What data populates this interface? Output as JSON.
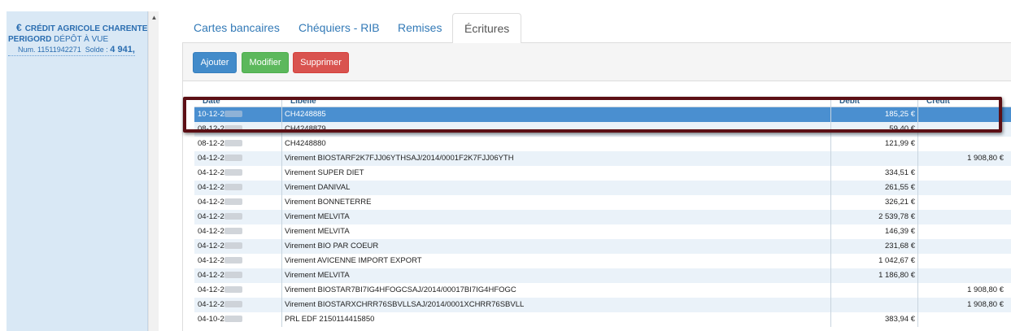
{
  "account": {
    "currency_symbol": "€",
    "bank_name": "CRÉDIT AGRICOLE CHARENTE",
    "region": "PERIGORD",
    "type": "DÉPÔT À VUE",
    "number_label": "Num. 11511942271",
    "balance_label": "Solde :",
    "balance_value": "4 941,"
  },
  "scroll_up_icon": "▲",
  "tabs": [
    {
      "label": "Cartes bancaires",
      "active": false
    },
    {
      "label": "Chéquiers - RIB",
      "active": false
    },
    {
      "label": "Remises",
      "active": false
    },
    {
      "label": "Écritures",
      "active": true
    }
  ],
  "toolbar": {
    "add_label": "Ajouter",
    "edit_label": "Modifier",
    "delete_label": "Supprimer"
  },
  "table": {
    "columns": [
      "Date",
      "Libellé",
      "Débit",
      "Crédit"
    ],
    "rows": [
      {
        "date": "10-12-2",
        "libelle": "CH4248885",
        "debit": "185,25 €",
        "credit": ""
      },
      {
        "date": "08-12-2",
        "libelle": "CH4248879",
        "debit": "59,40 €",
        "credit": ""
      },
      {
        "date": "08-12-2",
        "libelle": "CH4248880",
        "debit": "121,99 €",
        "credit": ""
      },
      {
        "date": "04-12-2",
        "libelle": "Virement BIOSTARF2K7FJJ06YTHSAJ/2014/0001F2K7FJJ06YTH",
        "debit": "",
        "credit": "1 908,80 €"
      },
      {
        "date": "04-12-2",
        "libelle": "Virement SUPER DIET",
        "debit": "334,51 €",
        "credit": ""
      },
      {
        "date": "04-12-2",
        "libelle": "Virement DANIVAL",
        "debit": "261,55 €",
        "credit": ""
      },
      {
        "date": "04-12-2",
        "libelle": "Virement BONNETERRE",
        "debit": "326,21 €",
        "credit": ""
      },
      {
        "date": "04-12-2",
        "libelle": "Virement MELVITA",
        "debit": "2 539,78 €",
        "credit": ""
      },
      {
        "date": "04-12-2",
        "libelle": "Virement MELVITA",
        "debit": "146,39 €",
        "credit": ""
      },
      {
        "date": "04-12-2",
        "libelle": "Virement BIO PAR COEUR",
        "debit": "231,68 €",
        "credit": ""
      },
      {
        "date": "04-12-2",
        "libelle": "Virement AVICENNE IMPORT EXPORT",
        "debit": "1 042,67 €",
        "credit": ""
      },
      {
        "date": "04-12-2",
        "libelle": "Virement MELVITA",
        "debit": "1 186,80 €",
        "credit": ""
      },
      {
        "date": "04-12-2",
        "libelle": "Virement BIOSTAR7BI7IG4HFOGCSAJ/2014/00017BI7IG4HFOGC",
        "debit": "",
        "credit": "1 908,80 €"
      },
      {
        "date": "04-12-2",
        "libelle": "Virement BIOSTARXCHRR76SBVLLSAJ/2014/0001XCHRR76SBVLL",
        "debit": "",
        "credit": "1 908,80 €"
      },
      {
        "date": "04-10-2",
        "libelle": "PRL EDF 2150114415850",
        "debit": "383,94 €",
        "credit": ""
      }
    ]
  },
  "colors": {
    "primary": "#428bca",
    "success": "#5cb85c",
    "danger": "#d9534f",
    "selected_row": "#4a8fd0",
    "highlight_box": "#5c0f15"
  }
}
